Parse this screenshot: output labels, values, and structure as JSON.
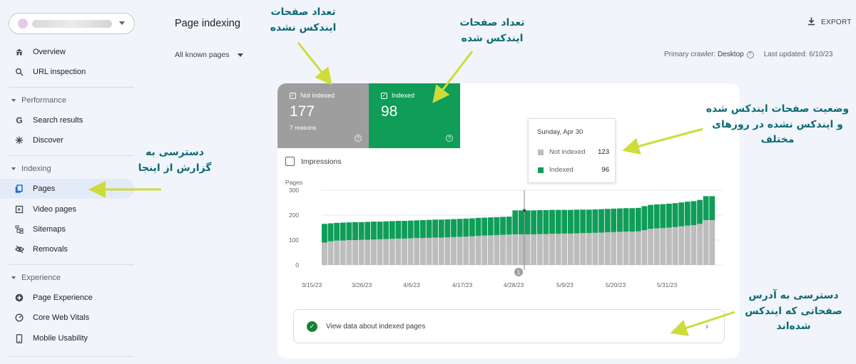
{
  "sidebar": {
    "items": {
      "overview": "Overview",
      "url_inspection": "URL inspection",
      "search_results": "Search results",
      "discover": "Discover",
      "pages": "Pages",
      "video_pages": "Video pages",
      "sitemaps": "Sitemaps",
      "removals": "Removals",
      "page_experience": "Page Experience",
      "core_web_vitals": "Core Web Vitals",
      "mobile_usability": "Mobile Usability"
    },
    "sections": {
      "performance": "Performance",
      "indexing": "Indexing",
      "experience": "Experience"
    }
  },
  "header": {
    "title": "Page indexing",
    "export_label": "EXPORT",
    "filter_label": "All known pages",
    "crawler_label": "Primary crawler:",
    "crawler_value": "Desktop",
    "updated_label": "Last updated: 6/10/23"
  },
  "tiles": {
    "not_indexed": {
      "label": "Not indexed",
      "count": "177",
      "sub": "7 reasons",
      "color": "#9e9e9e"
    },
    "indexed": {
      "label": "Indexed",
      "count": "98",
      "color": "#0f9d58"
    }
  },
  "impressions_label": "Impressions",
  "view_row_label": "View data about indexed pages",
  "tooltip": {
    "date": "Sunday, Apr 30",
    "not_indexed_label": "Not indexed",
    "not_indexed_value": "123",
    "indexed_label": "Indexed",
    "indexed_value": "96"
  },
  "annotations": {
    "not_indexed_count": "تعداد صفحات ایندکس نشده",
    "indexed_count": "تعداد صفحات ایندکس شده",
    "status_by_day": "وضعیت صفحات ایندکس شده و ایندکس نشده در روزهای مختلف",
    "report_access": "دسترسی به گزارش از اینجا",
    "indexed_urls": "دسترسی به آدرس صفحاتی که ایندکس شده‌اند"
  },
  "chart_data": {
    "type": "bar",
    "stacked": true,
    "ylabel": "Pages",
    "ylim": [
      0,
      300
    ],
    "yticks": [
      0,
      100,
      200,
      300
    ],
    "grid": true,
    "xticks": [
      "3/15/23",
      "3/26/23",
      "4/6/23",
      "4/17/23",
      "4/28/23",
      "5/9/23",
      "5/20/23",
      "5/31/23"
    ],
    "annotation_marker": "1",
    "series": [
      {
        "name": "Not indexed",
        "color": "#bdbdbd",
        "values": [
          90,
          95,
          98,
          98,
          100,
          100,
          101,
          101,
          102,
          103,
          104,
          105,
          106,
          106,
          107,
          108,
          108,
          109,
          110,
          110,
          111,
          112,
          113,
          114,
          115,
          117,
          118,
          119,
          120,
          121,
          122,
          123,
          123,
          123,
          123,
          124,
          124,
          125,
          125,
          126,
          126,
          127,
          128,
          128,
          129,
          130,
          131,
          132,
          133,
          134,
          134,
          135,
          140,
          145,
          147,
          148,
          150,
          152,
          155,
          158,
          160,
          165,
          180,
          180
        ]
      },
      {
        "name": "Indexed",
        "color": "#0f9d58",
        "values": [
          75,
          72,
          71,
          72,
          71,
          72,
          71,
          72,
          72,
          71,
          71,
          71,
          71,
          71,
          71,
          71,
          72,
          72,
          72,
          72,
          72,
          72,
          72,
          72,
          72,
          72,
          72,
          72,
          72,
          72,
          72,
          96,
          96,
          96,
          96,
          96,
          96,
          96,
          96,
          95,
          95,
          95,
          94,
          94,
          94,
          94,
          94,
          94,
          94,
          94,
          94,
          94,
          96,
          96,
          96,
          96,
          96,
          96,
          96,
          96,
          96,
          96,
          96,
          96
        ]
      }
    ]
  }
}
